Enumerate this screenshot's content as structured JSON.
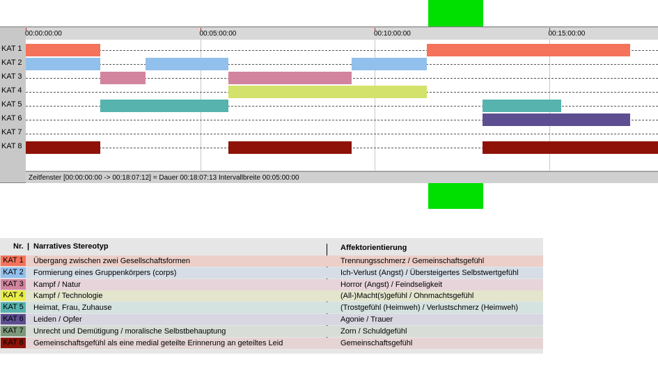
{
  "timeline": {
    "ticks": [
      "00:00:00:00",
      "00:05:00:00",
      "00:10:00:00",
      "00:15:00:00"
    ],
    "rows": [
      {
        "label": "KAT 1",
        "color": "#f4735a",
        "segments": [
          [
            0,
            2.13
          ],
          [
            11.5,
            17.33
          ]
        ]
      },
      {
        "label": "KAT 2",
        "color": "#92c0ec",
        "segments": [
          [
            0,
            2.13
          ],
          [
            3.43,
            5.8
          ],
          [
            9.35,
            11.5
          ]
        ]
      },
      {
        "label": "KAT 3",
        "color": "#d2849f",
        "segments": [
          [
            2.13,
            3.43
          ],
          [
            5.8,
            9.35
          ]
        ]
      },
      {
        "label": "KAT 4",
        "color": "#d2e26a",
        "segments": [
          [
            5.8,
            11.5
          ]
        ]
      },
      {
        "label": "KAT 5",
        "color": "#56b3ae",
        "segments": [
          [
            2.13,
            5.8
          ],
          [
            13.1,
            15.35
          ]
        ]
      },
      {
        "label": "KAT 6",
        "color": "#5d4e91",
        "segments": [
          [
            13.1,
            17.33
          ]
        ]
      },
      {
        "label": "KAT 7",
        "color": "#7c977a",
        "segments": []
      },
      {
        "label": "KAT 8",
        "color": "#8e1208",
        "segments": [
          [
            0,
            2.13
          ],
          [
            5.8,
            9.35
          ],
          [
            13.1,
            18.12
          ]
        ]
      }
    ],
    "status": "Zeitfenster [00:00:00:00 -> 00:18:07:12] = Dauer 00:18:07:13    Intervallbreite 00:05:00:00"
  },
  "legend": {
    "header_nr": "Nr.",
    "header_narrative": "Narratives Stereotyp",
    "header_affect": "Affektorientierung",
    "rows": [
      {
        "kat": "KAT 1",
        "color": "#f4735a",
        "row_bg": "#eccfc8",
        "narrative": "Übergang zwischen zwei Gesellschaftsformen",
        "affect": "Trennungsschmerz / Gemeinschaftsgefühl"
      },
      {
        "kat": "KAT 2",
        "color": "#92c0ec",
        "row_bg": "#d6dde6",
        "narrative": "Formierung eines Gruppenkörpers (corps)",
        "affect": "Ich-Verlust (Angst) / Übersteigertes Selbstwertgefühl"
      },
      {
        "kat": "KAT 3",
        "color": "#d2849f",
        "row_bg": "#e6d4da",
        "narrative": "Kampf / Natur",
        "affect": "Horror (Angst) / Feindseligkeit"
      },
      {
        "kat": "KAT 4",
        "color": "#e8ec4a",
        "row_bg": "#e3e5cd",
        "narrative": "Kampf / Technologie",
        "affect": "(All-)Macht(s)gefühl / Ohnmachtsgefühl"
      },
      {
        "kat": "KAT 5",
        "color": "#56b3ae",
        "row_bg": "#d4e2e0",
        "narrative": "Heimat, Frau, Zuhause",
        "affect": "(Trostgefühl (Heimweh) / Verlustschmerz (Heimweh)"
      },
      {
        "kat": "KAT 6",
        "color": "#5d4e91",
        "row_bg": "#d8d6e0",
        "narrative": "Leiden / Opfer",
        "affect": "Agonie / Trauer"
      },
      {
        "kat": "KAT 7",
        "color": "#7c977a",
        "row_bg": "#d8ddd8",
        "narrative": "Unrecht und Demütigung / moralische Selbstbehauptung",
        "affect": "Zorn / Schuldgefühl"
      },
      {
        "kat": "KAT 8",
        "color": "#8e1208",
        "row_bg": "#e6d4d4",
        "narrative": "Gemeinschaftsgefühl als eine medial geteilte Erinnerung an geteiltes Leid",
        "affect": "Gemeinschaftsgefühl"
      }
    ]
  }
}
